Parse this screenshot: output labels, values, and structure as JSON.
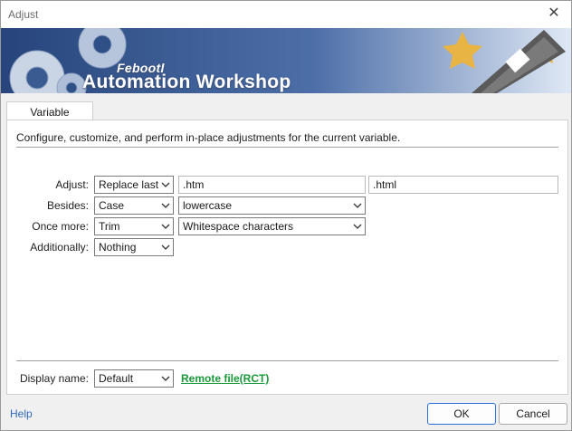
{
  "window": {
    "title": "Adjust",
    "close_glyph": "✕"
  },
  "banner": {
    "brand_small": "Febootl",
    "brand_big": "Automation Workshop",
    "icons": [
      "gears-icon",
      "pencil-icon",
      "stars-icon"
    ]
  },
  "tabs": [
    {
      "label": "Variable",
      "active": true
    }
  ],
  "description": "Configure, customize, and perform in-place adjustments for the current variable.",
  "rows": {
    "adjust": {
      "label": "Adjust:",
      "mode": "Replace last",
      "find": ".htm",
      "replace": ".html"
    },
    "besides": {
      "label": "Besides:",
      "mode": "Case",
      "option": "lowercase"
    },
    "once_more": {
      "label": "Once more:",
      "mode": "Trim",
      "option": "Whitespace characters"
    },
    "additionally": {
      "label": "Additionally:",
      "mode": "Nothing"
    }
  },
  "display_name": {
    "label": "Display name:",
    "value": "Default",
    "link": "Remote file(RCT)"
  },
  "footer": {
    "help": "Help",
    "ok": "OK",
    "cancel": "Cancel"
  },
  "colors": {
    "banner": "#2f4f87",
    "link": "#1a9a3a",
    "help": "#2f6ab8",
    "ok_border": "#2c6fd6"
  }
}
